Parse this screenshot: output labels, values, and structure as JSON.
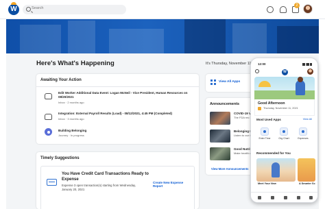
{
  "topbar": {
    "logo_letter": "W",
    "search_placeholder": "Search",
    "inbox_badge": "2"
  },
  "main": {
    "heading": "Here's What's Happening",
    "date": "It's Thursday, November 11"
  },
  "awaiting": {
    "title": "Awaiting Your Action",
    "tasks": [
      {
        "title": "Edit Worker Additional Data Event: Logan McNeil - Vice President, Human Resources on 08/20/2021",
        "meta": "Inbox · 2 months ago"
      },
      {
        "title": "Integration: External Payroll Results (Load) - 08/12/2021, 4:45 PM (Completed)",
        "meta": "Inbox · 3 months ago"
      },
      {
        "title": "Building Belonging",
        "meta": "Journey · In progress"
      }
    ]
  },
  "suggestions": {
    "title": "Timely Suggestions",
    "headline": "You Have Credit Card Transactions Ready to Expense",
    "body": "Expense 3 open transaction(s) starting from Wednesday, January 20, 2021",
    "action": "Create New Expense Report"
  },
  "apps": {
    "label": "View All Apps"
  },
  "announcements": {
    "title": "Announcements",
    "items": [
      {
        "title": "COVID-19 Va",
        "text": "The FDA rec of the curre"
      },
      {
        "title": "Belonging Em",
        "text": "Listen to our Officer, the"
      },
      {
        "title": "Good Nutrition",
        "text": "Make health assist you w"
      }
    ],
    "more": "View More Announcements"
  },
  "phone": {
    "time": "12:00",
    "logo_letter": "W",
    "greeting": "Good Afternoon",
    "date": "Thursday, November 11, 2021",
    "most_used_title": "Most Used Apps",
    "view_all": "View All",
    "apps": [
      "Enter Time",
      "Org Chart",
      "Expenses"
    ],
    "recommended_title": "Recommended for You",
    "cards": [
      "Meet Your New",
      "A Smarter Sc"
    ]
  },
  "colors": {
    "brand_blue": "#0b4ea2",
    "accent_orange": "#f0a92e",
    "link_blue": "#0b5bd3"
  }
}
